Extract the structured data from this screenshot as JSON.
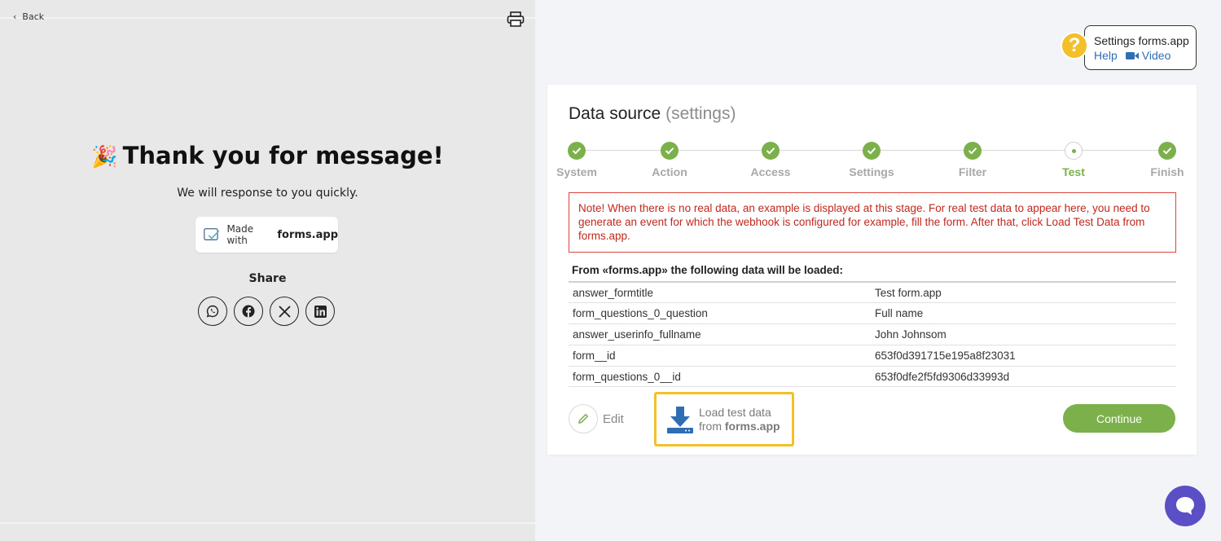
{
  "form_preview": {
    "back_label": "Back",
    "title": "Thank you for message!",
    "subtitle": "We will response to you quickly.",
    "made_with": "Made with",
    "brand": "forms.app",
    "share_label": "Share",
    "social": [
      "whatsapp-icon",
      "facebook-icon",
      "x-icon",
      "linkedin-icon"
    ]
  },
  "help": {
    "title": "Settings forms.app",
    "help_link": "Help",
    "video_link": "Video"
  },
  "card": {
    "title": "Data source",
    "title_muted": "(settings)",
    "steps": [
      {
        "label": "System",
        "state": "done"
      },
      {
        "label": "Action",
        "state": "done"
      },
      {
        "label": "Access",
        "state": "done"
      },
      {
        "label": "Settings",
        "state": "done"
      },
      {
        "label": "Filter",
        "state": "done"
      },
      {
        "label": "Test",
        "state": "current"
      },
      {
        "label": "Finish",
        "state": "done"
      }
    ],
    "note": "Note! When there is no real data, an example is displayed at this stage. For real test data to appear here, you need to generate an event for which the webhook is configured for example, fill the form. After that, click Load Test Data from forms.app.",
    "table_heading": "From «forms.app» the following data will be loaded:",
    "rows": [
      {
        "key": "answer_formtitle",
        "value": "Test form.app"
      },
      {
        "key": "form_questions_0_question",
        "value": "Full name"
      },
      {
        "key": "answer_userinfo_fullname",
        "value": "John Johnsom"
      },
      {
        "key": "form__id",
        "value": "653f0d391715e195a8f23031"
      },
      {
        "key": "form_questions_0__id",
        "value": "653f0dfe2f5fd9306d33993d"
      }
    ],
    "edit_label": "Edit",
    "load_line1": "Load test data",
    "load_from": "from",
    "load_brand": "forms.app",
    "continue_label": "Continue"
  },
  "colors": {
    "accent_green": "#7bb04a",
    "highlight_yellow": "#f4c02a",
    "note_red": "#c0281d",
    "link_blue": "#2f6db5",
    "chat_purple": "#5b4fc5"
  }
}
